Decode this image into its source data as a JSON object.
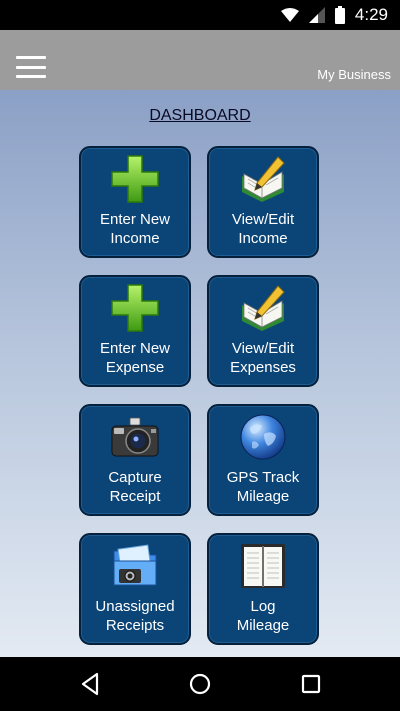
{
  "status_bar": {
    "time": "4:29",
    "icons": [
      "wifi-icon",
      "signal-icon",
      "battery-icon"
    ]
  },
  "app_bar": {
    "menu_icon": "hamburger-menu-icon",
    "title": "My Business"
  },
  "dashboard": {
    "title": "DASHBOARD",
    "tiles": [
      {
        "label": "Enter New\nIncome",
        "icon": "plus-icon"
      },
      {
        "label": "View/Edit\nIncome",
        "icon": "notebook-pencil-icon"
      },
      {
        "label": "Enter New\nExpense",
        "icon": "plus-icon"
      },
      {
        "label": "View/Edit\nExpenses",
        "icon": "notebook-pencil-icon"
      },
      {
        "label": "Capture\nReceipt",
        "icon": "camera-icon"
      },
      {
        "label": "GPS Track\nMileage",
        "icon": "globe-icon"
      },
      {
        "label": "Unassigned\nReceipts",
        "icon": "photo-folder-icon"
      },
      {
        "label": "Log\nMileage",
        "icon": "open-book-icon"
      }
    ]
  },
  "nav_bar": {
    "buttons": [
      "back-icon",
      "home-icon",
      "recents-icon"
    ]
  },
  "colors": {
    "tile_bg": "#0b4476",
    "app_bar": "#9c9c9c",
    "content_gradient_top": "#8ba0c6",
    "content_gradient_bottom": "#e3eaf3"
  }
}
